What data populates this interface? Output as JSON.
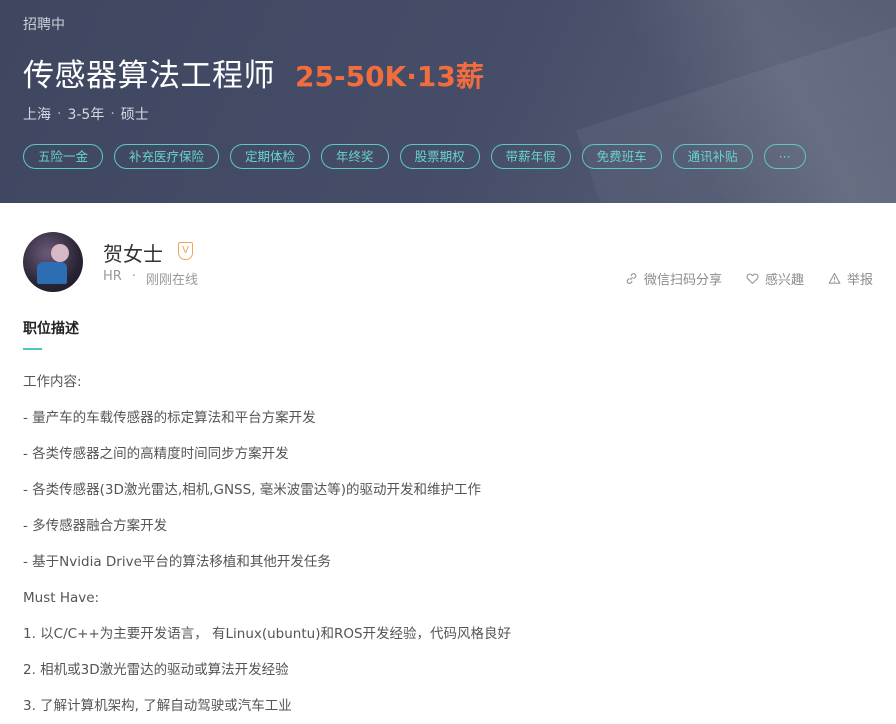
{
  "header": {
    "status": "招聘中",
    "title": "传感器算法工程师",
    "salary": "25-50K·13薪",
    "meta": [
      "上海",
      "3-5年",
      "硕士"
    ],
    "tags": [
      "五险一金",
      "补充医疗保险",
      "定期体检",
      "年终奖",
      "股票期权",
      "带薪年假",
      "免费班车",
      "通讯补贴",
      "···"
    ]
  },
  "recruiter": {
    "name": "贺女士",
    "verified_badge": "V",
    "role": "HR",
    "online": "刚刚在线",
    "actions": {
      "share": "微信扫码分享",
      "interest": "感兴趣",
      "report": "举报"
    }
  },
  "job_description": {
    "heading": "职位描述",
    "lines": [
      "工作内容:",
      "- 量产车的车载传感器的标定算法和平台方案开发",
      "- 各类传感器之间的高精度时间同步方案开发",
      "- 各类传感器(3D激光雷达,相机,GNSS, 毫米波雷达等)的驱动开发和维护工作",
      "- 多传感器融合方案开发",
      "- 基于Nvidia Drive平台的算法移植和其他开发任务",
      "Must Have:",
      "1. 以C/C++为主要开发语言， 有Linux(ubuntu)和ROS开发经验，代码风格良好",
      "2. 相机或3D激光雷达的驱动或算法开发经验",
      "3. 了解计算机架构, 了解自动驾驶或汽车工业"
    ]
  },
  "colors": {
    "header_bg": "#454d68",
    "salary": "#f26d3d",
    "tag_accent": "#5dc8c1",
    "verified": "#f0a35c"
  }
}
